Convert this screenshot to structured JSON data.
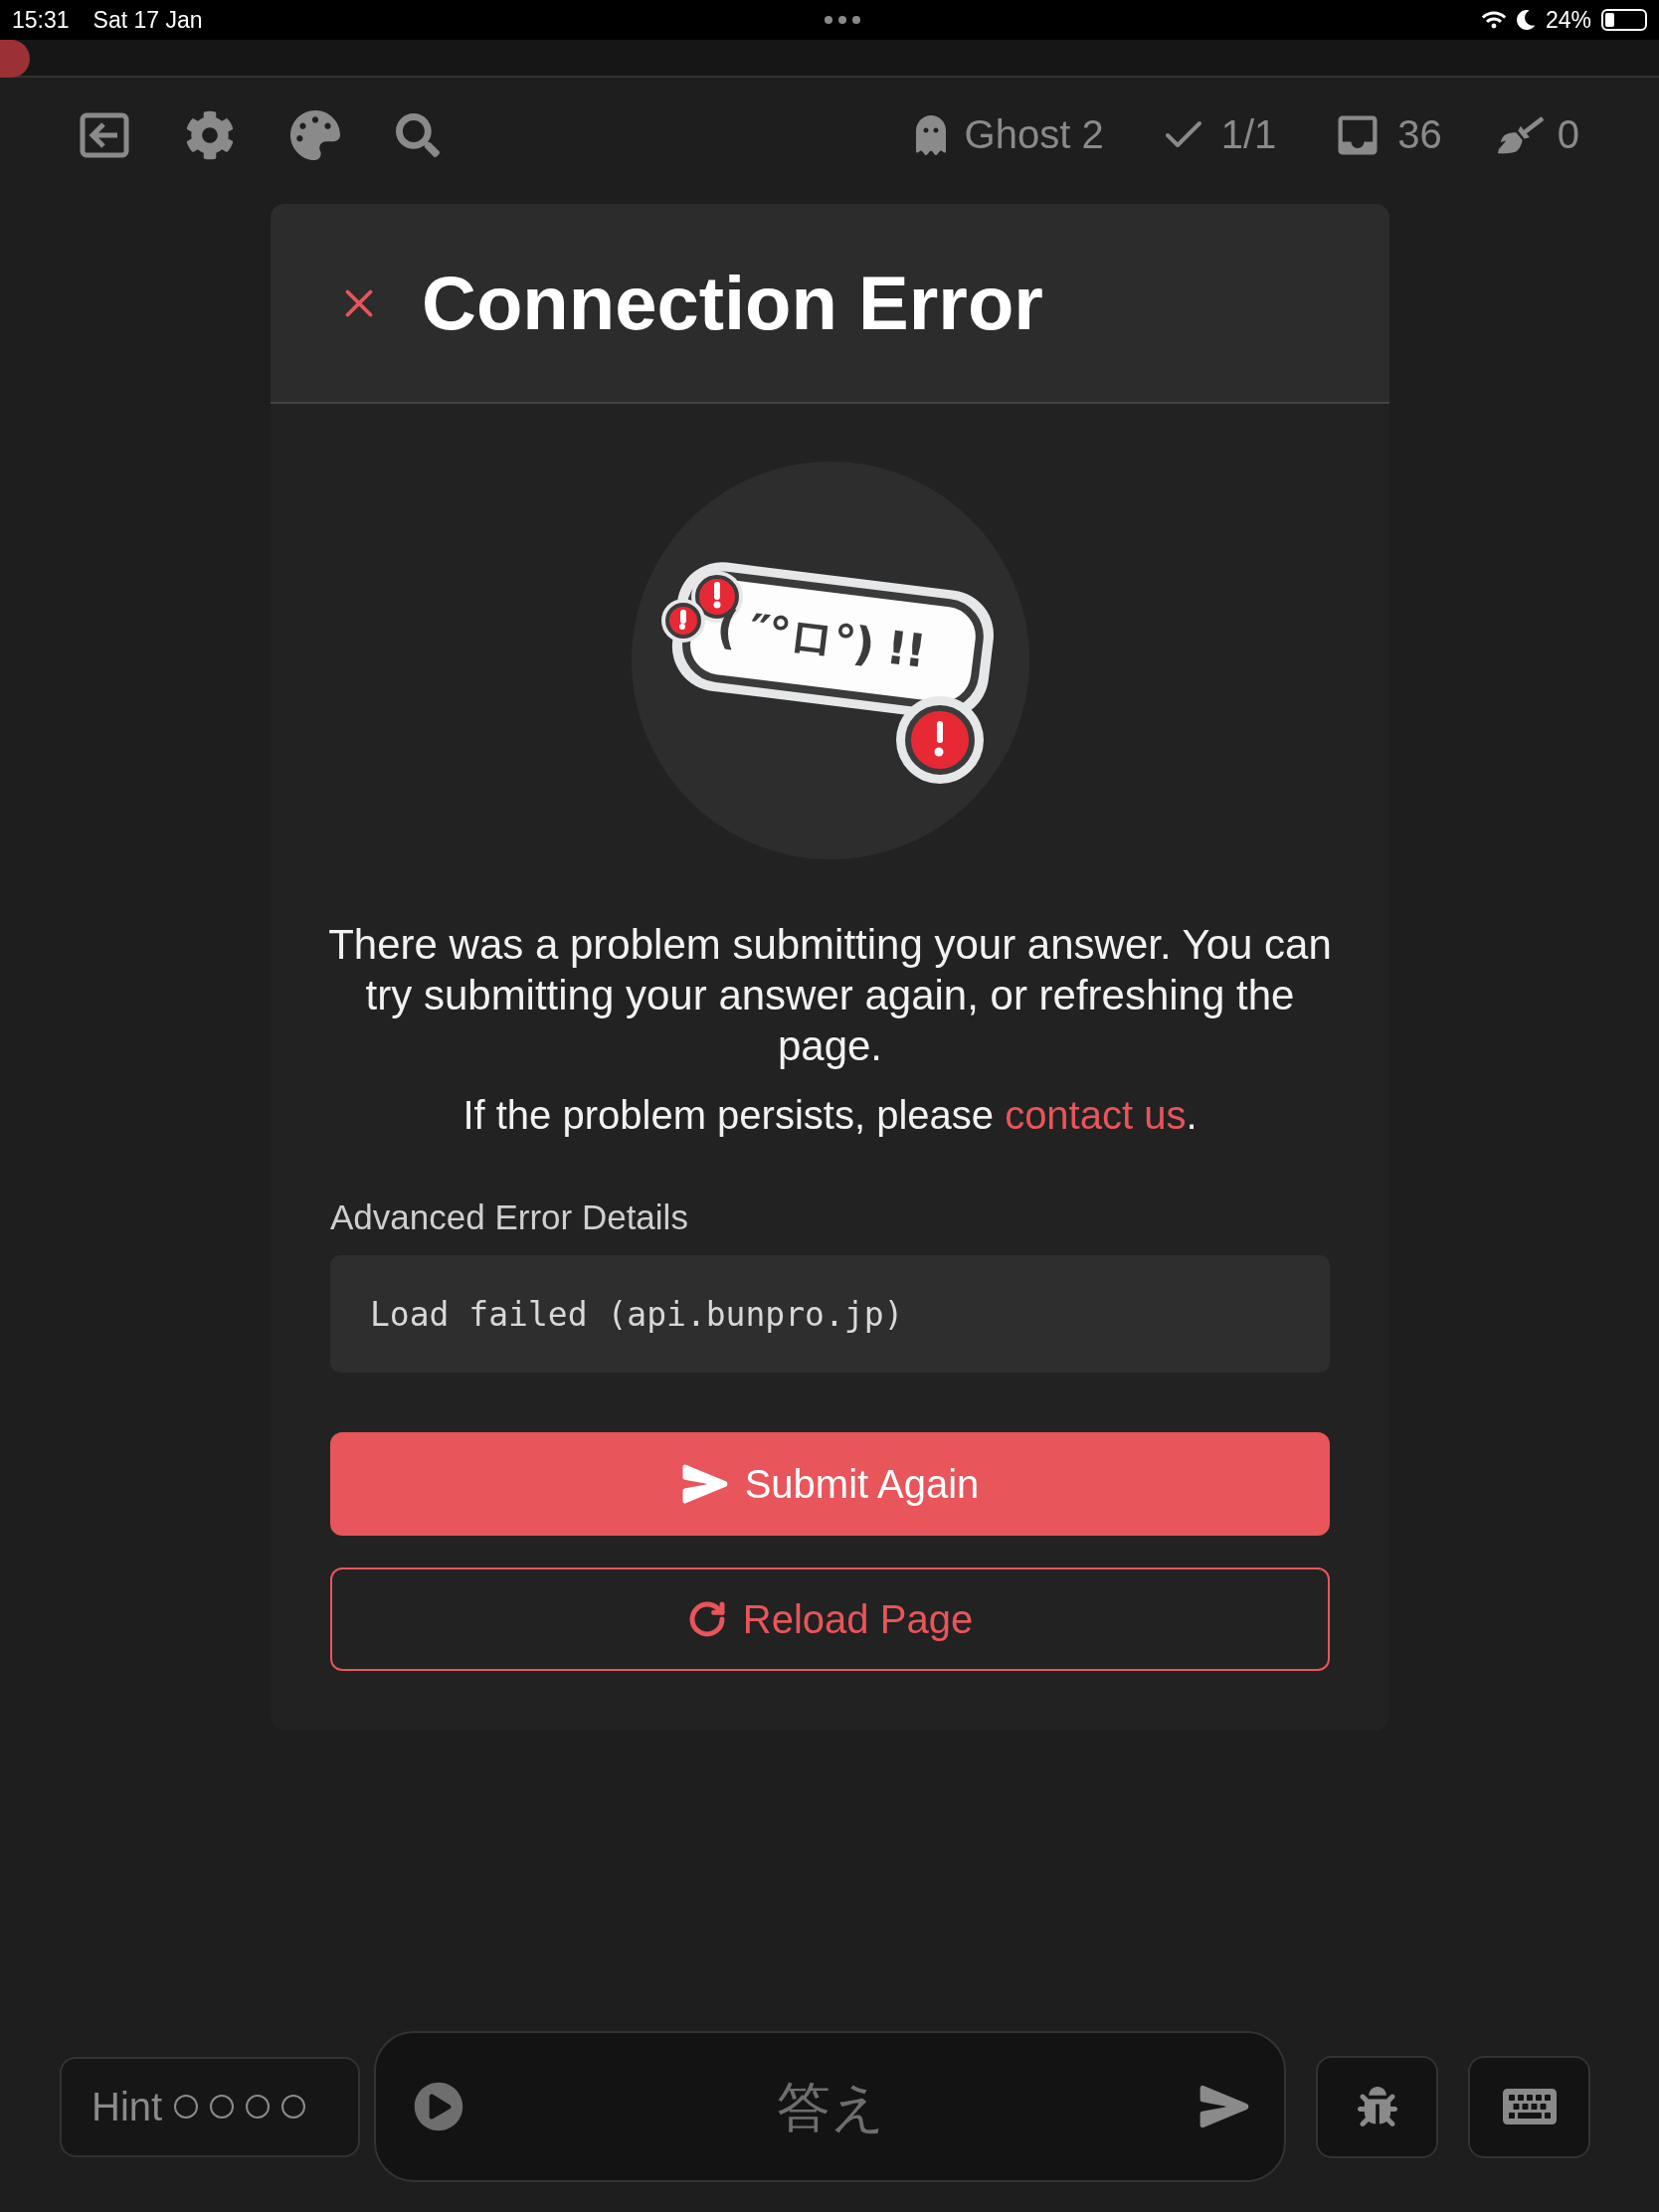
{
  "status_bar": {
    "time": "15:31",
    "date": "Sat 17 Jan",
    "battery": "24%"
  },
  "progress": {
    "level": 0.018
  },
  "toolbar": {
    "ghost": "Ghost 2",
    "correct": "1/1",
    "reviews": "36",
    "new_items": "0"
  },
  "dialog": {
    "title": "Connection Error",
    "kaomoji": "( ″°ロ°) !!",
    "message": "There was a problem submitting your answer. You can try submitting your answer again, or refreshing the page.",
    "persist_text": "If the problem persists, please ",
    "link": "contact us",
    "persist_end": ".",
    "details_label": "Advanced Error Details",
    "details": "Load failed (api.bunpro.jp)",
    "buttons": [
      {
        "label": "Submit Again",
        "kind": "primary"
      },
      {
        "label": "Reload Page",
        "kind": "secondary"
      }
    ]
  },
  "answer_bar": {
    "hint_label": "Hint",
    "hints": [
      {
        "used": false
      },
      {
        "used": false
      },
      {
        "used": false
      },
      {
        "used": false
      }
    ],
    "placeholder": "答え"
  }
}
